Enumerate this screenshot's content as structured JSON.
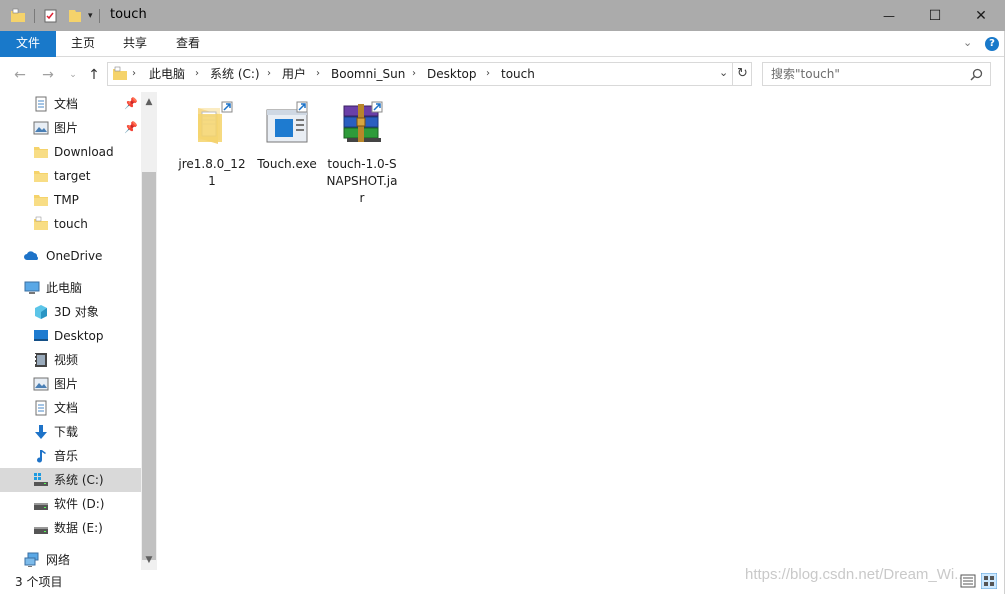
{
  "window": {
    "title": "touch",
    "minimize_glyph": "—",
    "maximize_glyph": "☐",
    "close_glyph": "✕"
  },
  "ribbon": {
    "tabs": [
      "文件",
      "主页",
      "共享",
      "查看"
    ]
  },
  "address": {
    "crumbs": [
      "此电脑",
      "系统 (C:)",
      "用户",
      "Boomni_Sun",
      "Desktop",
      "touch"
    ]
  },
  "search": {
    "placeholder": "搜索\"touch\""
  },
  "nav": {
    "quick_access": [
      {
        "label": "文档",
        "icon": "document-icon",
        "pinned": true
      },
      {
        "label": "图片",
        "icon": "picture-icon",
        "pinned": true
      },
      {
        "label": "Download",
        "icon": "folder-icon",
        "pinned": false
      },
      {
        "label": "target",
        "icon": "folder-icon",
        "pinned": false
      },
      {
        "label": "TMP",
        "icon": "folder-icon",
        "pinned": false
      },
      {
        "label": "touch",
        "icon": "folder-icon",
        "pinned": false
      }
    ],
    "onedrive": "OneDrive",
    "this_pc": "此电脑",
    "pc_items": [
      {
        "label": "3D 对象",
        "icon": "3d-objects-icon"
      },
      {
        "label": "Desktop",
        "icon": "desktop-icon"
      },
      {
        "label": "视频",
        "icon": "video-icon"
      },
      {
        "label": "图片",
        "icon": "picture-icon"
      },
      {
        "label": "文档",
        "icon": "document-icon"
      },
      {
        "label": "下载",
        "icon": "download-icon"
      },
      {
        "label": "音乐",
        "icon": "music-icon"
      },
      {
        "label": "系统 (C:)",
        "icon": "system-drive-icon",
        "selected": true
      },
      {
        "label": "软件 (D:)",
        "icon": "drive-icon"
      },
      {
        "label": "数据 (E:)",
        "icon": "drive-icon"
      }
    ],
    "network": "网络"
  },
  "files": [
    {
      "name": "jre1.8.0_121",
      "icon": "shortcut-folder-icon"
    },
    {
      "name": "Touch.exe",
      "icon": "exe-shortcut-icon"
    },
    {
      "name": "touch-1.0-SNAPSHOT.jar",
      "icon": "winrar-archive-icon"
    }
  ],
  "status": {
    "count": "3 个项目"
  },
  "watermark": "https://blog.csdn.net/Dream_Wi..."
}
